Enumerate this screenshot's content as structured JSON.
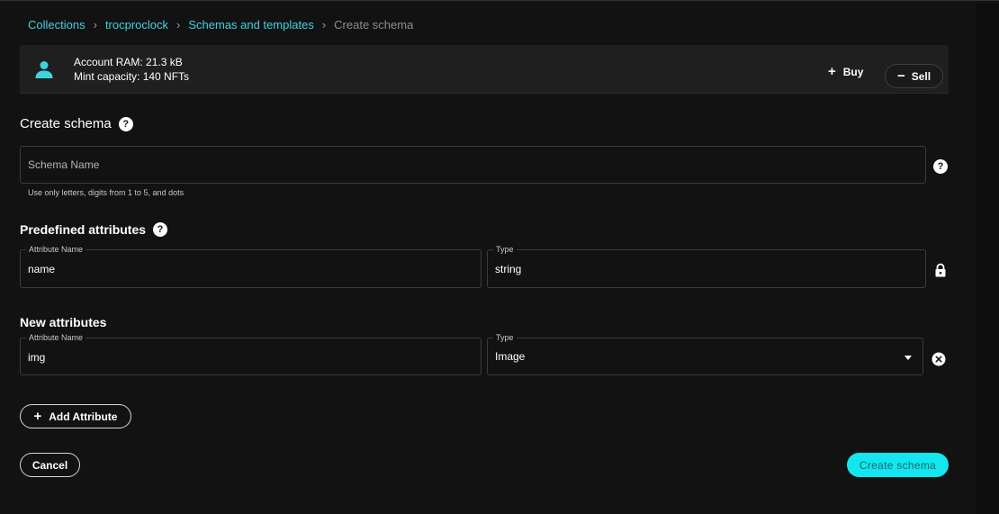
{
  "breadcrumb": {
    "items": [
      "Collections",
      "trocproclock",
      "Schemas and templates"
    ],
    "separator": "›",
    "current": "Create schema"
  },
  "account": {
    "ram": "Account RAM: 21.3 kB",
    "mint": "Mint capacity: 140 NFTs",
    "buy_label": "Buy",
    "sell_label": "Sell",
    "icon": "user-icon"
  },
  "create_schema": {
    "title": "Create schema",
    "name_placeholder": "Schema Name",
    "helper": "Use only letters, digits from 1 to 5, and dots"
  },
  "predefined": {
    "title": "Predefined attributes",
    "attr_label": "Attribute Name",
    "attr_value": "name",
    "type_label": "Type",
    "type_value": "string"
  },
  "new_attrs": {
    "title": "New attributes",
    "attr_label": "Attribute Name",
    "attr_value": "img",
    "type_label": "Type",
    "type_value": "Image"
  },
  "actions": {
    "add_attribute": "Add Attribute",
    "cancel": "Cancel",
    "create": "Create schema"
  },
  "colors": {
    "accent": "#3fd2e0",
    "primary_button": "#13e6ef",
    "background": "#121212",
    "panel": "#1f1f1f"
  }
}
